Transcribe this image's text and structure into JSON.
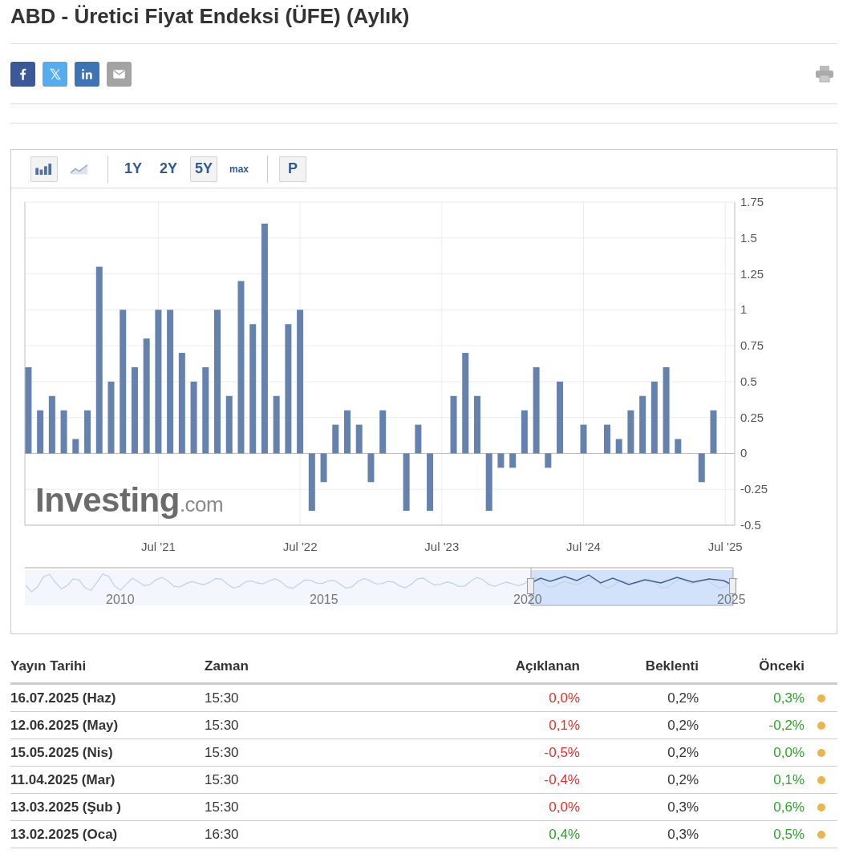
{
  "title": "ABD - Üretici Fiyat Endeksi (ÜFE) (Aylık)",
  "share_buttons": [
    {
      "kind": "facebook"
    },
    {
      "kind": "x"
    },
    {
      "kind": "linkedin"
    },
    {
      "kind": "email"
    }
  ],
  "toolbar": {
    "chart_types": [
      {
        "kind": "bar",
        "selected": true
      },
      {
        "kind": "line",
        "selected": false
      }
    ],
    "ranges": [
      {
        "label": "1Y",
        "selected": false
      },
      {
        "label": "2Y",
        "selected": false
      },
      {
        "label": "5Y",
        "selected": true
      },
      {
        "label": "max",
        "selected": false
      }
    ],
    "p_button": "P"
  },
  "chart_logo": "**Investing**.com",
  "chart_data": {
    "type": "bar",
    "categories": [
      null,
      null,
      null,
      null,
      null,
      null,
      null,
      null,
      null,
      null,
      null,
      "Jul '21",
      null,
      null,
      null,
      null,
      null,
      null,
      null,
      null,
      null,
      null,
      null,
      "Jul '22",
      null,
      null,
      null,
      null,
      null,
      null,
      null,
      null,
      null,
      null,
      null,
      "Jul '23",
      null,
      null,
      null,
      null,
      null,
      null,
      null,
      null,
      null,
      null,
      null,
      "Jul '24",
      null,
      null,
      null,
      null,
      null,
      null,
      null,
      null,
      null,
      null,
      null,
      "Jul '25"
    ],
    "grid": true,
    "series": [
      {
        "color": "#6482ad",
        "values": [
          0.6,
          0.3,
          0.4,
          0.3,
          0.1,
          0.3,
          1.3,
          0.5,
          1.0,
          0.6,
          0.8,
          1.0,
          1.0,
          0.7,
          0.5,
          0.6,
          1.0,
          0.4,
          1.2,
          0.9,
          1.6,
          0.4,
          0.9,
          1.0,
          -0.4,
          -0.2,
          0.2,
          0.3,
          0.2,
          -0.2,
          0.3,
          0.0,
          -0.4,
          0.2,
          -0.4,
          0.0,
          0.4,
          0.7,
          0.4,
          -0.4,
          -0.1,
          -0.1,
          0.3,
          0.6,
          -0.1,
          0.5,
          0.0,
          0.2,
          0.0,
          0.2,
          0.1,
          0.3,
          0.4,
          0.5,
          0.6,
          0.1,
          0.0,
          -0.2,
          0.3,
          null
        ]
      }
    ],
    "ylim": [
      -0.5,
      1.75
    ],
    "yticks": [
      {
        "value": -0.5,
        "label": "-0.5"
      },
      {
        "value": -0.25,
        "label": "-0.25"
      },
      {
        "value": 0,
        "label": "0"
      },
      {
        "value": 0.25,
        "label": "0.25"
      },
      {
        "value": 0.5,
        "label": "0.5"
      },
      {
        "value": 0.75,
        "label": "0.75"
      },
      {
        "value": 1,
        "label": "1"
      },
      {
        "value": 1.25,
        "label": "1.25"
      },
      {
        "value": 1.5,
        "label": "1.5"
      },
      {
        "value": 1.75,
        "label": "1.75"
      }
    ]
  },
  "navigator": {
    "years": [
      "2010",
      "2015",
      "2020",
      "2025"
    ]
  },
  "table": {
    "columns": [
      "Yayın Tarihi",
      "Zaman",
      "Açıklanan",
      "Beklenti",
      "Önceki"
    ],
    "rows": [
      {
        "date": "16.07.2025 (Haz)",
        "time": "15:30",
        "actual": "0,0%",
        "actual_up": false,
        "forecast": "0,2%",
        "previous": "0,3%",
        "previous_up": true,
        "color": "#e8b54f"
      },
      {
        "date": "12.06.2025 (May)",
        "time": "15:30",
        "actual": "0,1%",
        "actual_up": false,
        "forecast": "0,2%",
        "previous": "-0,2%",
        "previous_up": true,
        "color": "#e8b54f"
      },
      {
        "date": "15.05.2025 (Nis)",
        "time": "15:30",
        "actual": "-0,5%",
        "actual_up": false,
        "forecast": "0,2%",
        "previous": "0,0%",
        "previous_up": true,
        "color": "#e8b54f"
      },
      {
        "date": "11.04.2025 (Mar)",
        "time": "15:30",
        "actual": "-0,4%",
        "actual_up": false,
        "forecast": "0,2%",
        "previous": "0,1%",
        "previous_up": true,
        "color": "#e8b54f"
      },
      {
        "date": "13.03.2025 (Şub )",
        "time": "15:30",
        "actual": "0,0%",
        "actual_up": false,
        "forecast": "0,3%",
        "previous": "0,6%",
        "previous_up": true,
        "color": "#e8b54f"
      },
      {
        "date": "13.02.2025 (Oca)",
        "time": "16:30",
        "actual": "0,4%",
        "actual_up": true,
        "forecast": "0,3%",
        "previous": "0,5%",
        "previous_up": true,
        "color": "#e8b54f"
      }
    ]
  }
}
